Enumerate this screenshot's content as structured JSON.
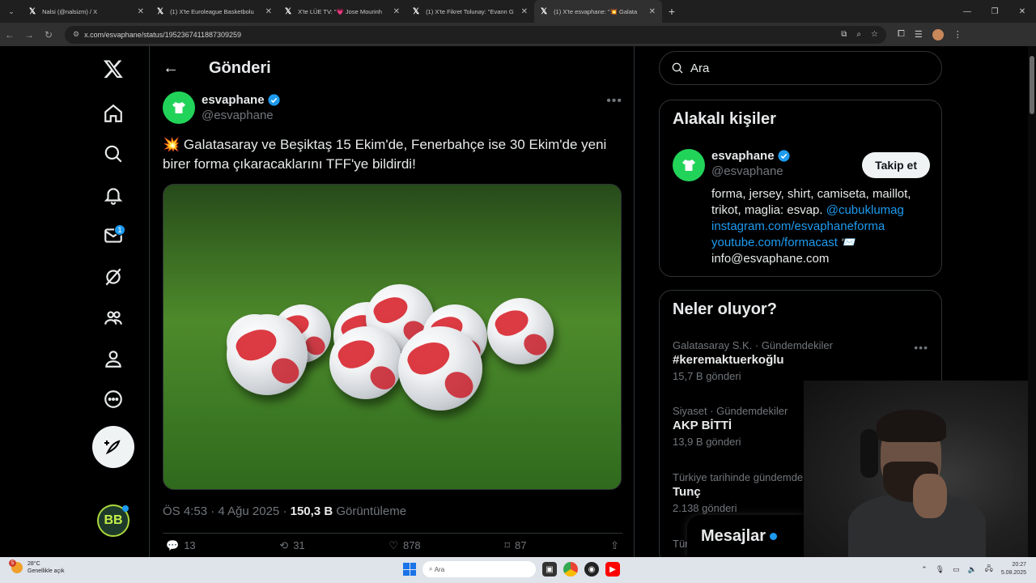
{
  "browser": {
    "tabs": [
      {
        "title": "Nalsi (@nalsizm) / X",
        "active": false
      },
      {
        "title": "(1) X'te Euroleague Basketbolu",
        "active": false
      },
      {
        "title": "X'te LÜE TV: \"💗 Jose Mourinh",
        "active": false
      },
      {
        "title": "(1) X'te Fikret Tolunay: \"Evann G",
        "active": false
      },
      {
        "title": "(1) X'te esvaphane: \"💥 Galata",
        "active": true
      }
    ],
    "url": "x.com/esvaphane/status/1952367411887309259"
  },
  "nav": {
    "messages_badge": "1"
  },
  "main": {
    "title": "Gönderi",
    "author": {
      "display_name": "esvaphane",
      "handle": "@esvaphane"
    },
    "tweet_text": "Galatasaray ve Beşiktaş 15 Ekim'de, Fenerbahçe ise 30 Ekim'de yeni birer forma çıkaracaklarını TFF'ye bildirdi!",
    "tweet_emoji": "💥",
    "meta_time": "ÖS 4:53 · 4 Ağu 2025 · ",
    "meta_views": "150,3 B",
    "meta_views_label": " Görüntüleme",
    "actions": {
      "replies": "13",
      "reposts": "31",
      "likes": "878",
      "bookmarks": "87"
    }
  },
  "right": {
    "search_placeholder": "Ara",
    "related": {
      "title": "Alakalı kişiler",
      "name": "esvaphane",
      "handle": "@esvaphane",
      "follow": "Takip et",
      "bio_line1": "forma, jersey, shirt, camiseta, maillot, trikot, maglia: esvap. ",
      "bio_mention": "@cubuklumag",
      "bio_link1": "instagram.com/esvaphaneforma",
      "bio_link2": "youtube.com/formacast",
      "bio_emoji": " 📨",
      "bio_email": "info@esvaphane.com"
    },
    "trends": {
      "title": "Neler oluyor?",
      "items": [
        {
          "context": "Galatasaray S.K. · Gündemdekiler",
          "name": "#keremaktuerkoğlu",
          "count": "15,7 B gönderi"
        },
        {
          "context": "Siyaset · Gündemdekiler",
          "name": "AKP BİTTİ",
          "count": "13,9 B gönderi"
        },
        {
          "context": "Türkiye tarihinde gündemde",
          "name": "Tunç",
          "count": "2.138 gönderi"
        },
        {
          "context": "Tür",
          "name": "",
          "count": ""
        }
      ]
    },
    "messages": "Mesajlar"
  },
  "taskbar": {
    "weather_badge": "5",
    "temp": "28°C",
    "condition": "Genellikle açık",
    "search": "Ara",
    "time": "20:27",
    "date": "5.08.2025"
  }
}
